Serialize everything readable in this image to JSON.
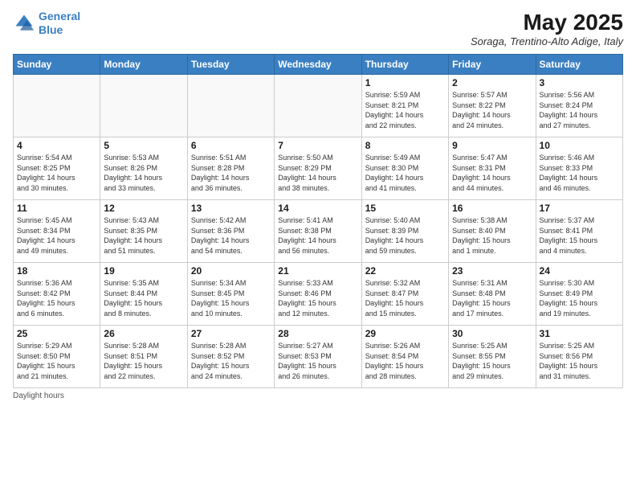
{
  "header": {
    "logo_line1": "General",
    "logo_line2": "Blue",
    "month_title": "May 2025",
    "location": "Soraga, Trentino-Alto Adige, Italy"
  },
  "weekdays": [
    "Sunday",
    "Monday",
    "Tuesday",
    "Wednesday",
    "Thursday",
    "Friday",
    "Saturday"
  ],
  "weeks": [
    [
      {
        "day": "",
        "info": ""
      },
      {
        "day": "",
        "info": ""
      },
      {
        "day": "",
        "info": ""
      },
      {
        "day": "",
        "info": ""
      },
      {
        "day": "1",
        "info": "Sunrise: 5:59 AM\nSunset: 8:21 PM\nDaylight: 14 hours\nand 22 minutes."
      },
      {
        "day": "2",
        "info": "Sunrise: 5:57 AM\nSunset: 8:22 PM\nDaylight: 14 hours\nand 24 minutes."
      },
      {
        "day": "3",
        "info": "Sunrise: 5:56 AM\nSunset: 8:24 PM\nDaylight: 14 hours\nand 27 minutes."
      }
    ],
    [
      {
        "day": "4",
        "info": "Sunrise: 5:54 AM\nSunset: 8:25 PM\nDaylight: 14 hours\nand 30 minutes."
      },
      {
        "day": "5",
        "info": "Sunrise: 5:53 AM\nSunset: 8:26 PM\nDaylight: 14 hours\nand 33 minutes."
      },
      {
        "day": "6",
        "info": "Sunrise: 5:51 AM\nSunset: 8:28 PM\nDaylight: 14 hours\nand 36 minutes."
      },
      {
        "day": "7",
        "info": "Sunrise: 5:50 AM\nSunset: 8:29 PM\nDaylight: 14 hours\nand 38 minutes."
      },
      {
        "day": "8",
        "info": "Sunrise: 5:49 AM\nSunset: 8:30 PM\nDaylight: 14 hours\nand 41 minutes."
      },
      {
        "day": "9",
        "info": "Sunrise: 5:47 AM\nSunset: 8:31 PM\nDaylight: 14 hours\nand 44 minutes."
      },
      {
        "day": "10",
        "info": "Sunrise: 5:46 AM\nSunset: 8:33 PM\nDaylight: 14 hours\nand 46 minutes."
      }
    ],
    [
      {
        "day": "11",
        "info": "Sunrise: 5:45 AM\nSunset: 8:34 PM\nDaylight: 14 hours\nand 49 minutes."
      },
      {
        "day": "12",
        "info": "Sunrise: 5:43 AM\nSunset: 8:35 PM\nDaylight: 14 hours\nand 51 minutes."
      },
      {
        "day": "13",
        "info": "Sunrise: 5:42 AM\nSunset: 8:36 PM\nDaylight: 14 hours\nand 54 minutes."
      },
      {
        "day": "14",
        "info": "Sunrise: 5:41 AM\nSunset: 8:38 PM\nDaylight: 14 hours\nand 56 minutes."
      },
      {
        "day": "15",
        "info": "Sunrise: 5:40 AM\nSunset: 8:39 PM\nDaylight: 14 hours\nand 59 minutes."
      },
      {
        "day": "16",
        "info": "Sunrise: 5:38 AM\nSunset: 8:40 PM\nDaylight: 15 hours\nand 1 minute."
      },
      {
        "day": "17",
        "info": "Sunrise: 5:37 AM\nSunset: 8:41 PM\nDaylight: 15 hours\nand 4 minutes."
      }
    ],
    [
      {
        "day": "18",
        "info": "Sunrise: 5:36 AM\nSunset: 8:42 PM\nDaylight: 15 hours\nand 6 minutes."
      },
      {
        "day": "19",
        "info": "Sunrise: 5:35 AM\nSunset: 8:44 PM\nDaylight: 15 hours\nand 8 minutes."
      },
      {
        "day": "20",
        "info": "Sunrise: 5:34 AM\nSunset: 8:45 PM\nDaylight: 15 hours\nand 10 minutes."
      },
      {
        "day": "21",
        "info": "Sunrise: 5:33 AM\nSunset: 8:46 PM\nDaylight: 15 hours\nand 12 minutes."
      },
      {
        "day": "22",
        "info": "Sunrise: 5:32 AM\nSunset: 8:47 PM\nDaylight: 15 hours\nand 15 minutes."
      },
      {
        "day": "23",
        "info": "Sunrise: 5:31 AM\nSunset: 8:48 PM\nDaylight: 15 hours\nand 17 minutes."
      },
      {
        "day": "24",
        "info": "Sunrise: 5:30 AM\nSunset: 8:49 PM\nDaylight: 15 hours\nand 19 minutes."
      }
    ],
    [
      {
        "day": "25",
        "info": "Sunrise: 5:29 AM\nSunset: 8:50 PM\nDaylight: 15 hours\nand 21 minutes."
      },
      {
        "day": "26",
        "info": "Sunrise: 5:28 AM\nSunset: 8:51 PM\nDaylight: 15 hours\nand 22 minutes."
      },
      {
        "day": "27",
        "info": "Sunrise: 5:28 AM\nSunset: 8:52 PM\nDaylight: 15 hours\nand 24 minutes."
      },
      {
        "day": "28",
        "info": "Sunrise: 5:27 AM\nSunset: 8:53 PM\nDaylight: 15 hours\nand 26 minutes."
      },
      {
        "day": "29",
        "info": "Sunrise: 5:26 AM\nSunset: 8:54 PM\nDaylight: 15 hours\nand 28 minutes."
      },
      {
        "day": "30",
        "info": "Sunrise: 5:25 AM\nSunset: 8:55 PM\nDaylight: 15 hours\nand 29 minutes."
      },
      {
        "day": "31",
        "info": "Sunrise: 5:25 AM\nSunset: 8:56 PM\nDaylight: 15 hours\nand 31 minutes."
      }
    ]
  ],
  "footer": {
    "note": "Daylight hours"
  }
}
